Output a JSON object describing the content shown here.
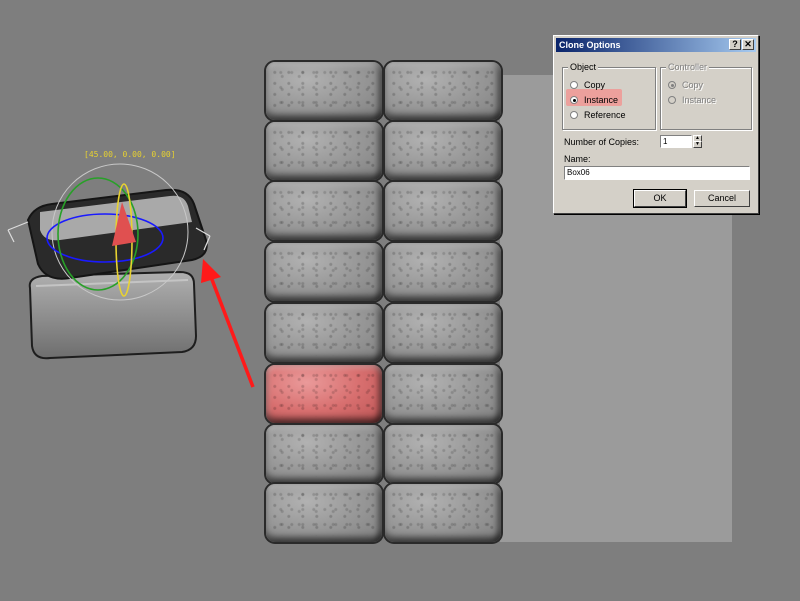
{
  "viewport": {
    "coordinate_readout": "[45.00, 0.00, 0.00]"
  },
  "dialog": {
    "title": "Clone Options",
    "help_label": "?",
    "close_label": "✕",
    "object_group": {
      "label": "Object",
      "options": [
        "Copy",
        "Instance",
        "Reference"
      ],
      "selected": "Instance"
    },
    "controller_group": {
      "label": "Controller",
      "options": [
        "Copy",
        "Instance"
      ],
      "selected": "Copy"
    },
    "copies_label": "Number of Copies:",
    "copies_value": "1",
    "name_label": "Name:",
    "name_value": "Box06",
    "ok_label": "OK",
    "cancel_label": "Cancel"
  },
  "colors": {
    "viewport_bg": "#7e7e7e",
    "selection_highlight": "#d86f6f",
    "arrow": "#ff1a1a",
    "gizmo_axis_yellow": "#e8d230"
  },
  "icons": [
    "help-icon",
    "close-icon",
    "spinner-up-icon",
    "spinner-down-icon",
    "rotate-gizmo-icon",
    "arrow-indicator-icon"
  ]
}
